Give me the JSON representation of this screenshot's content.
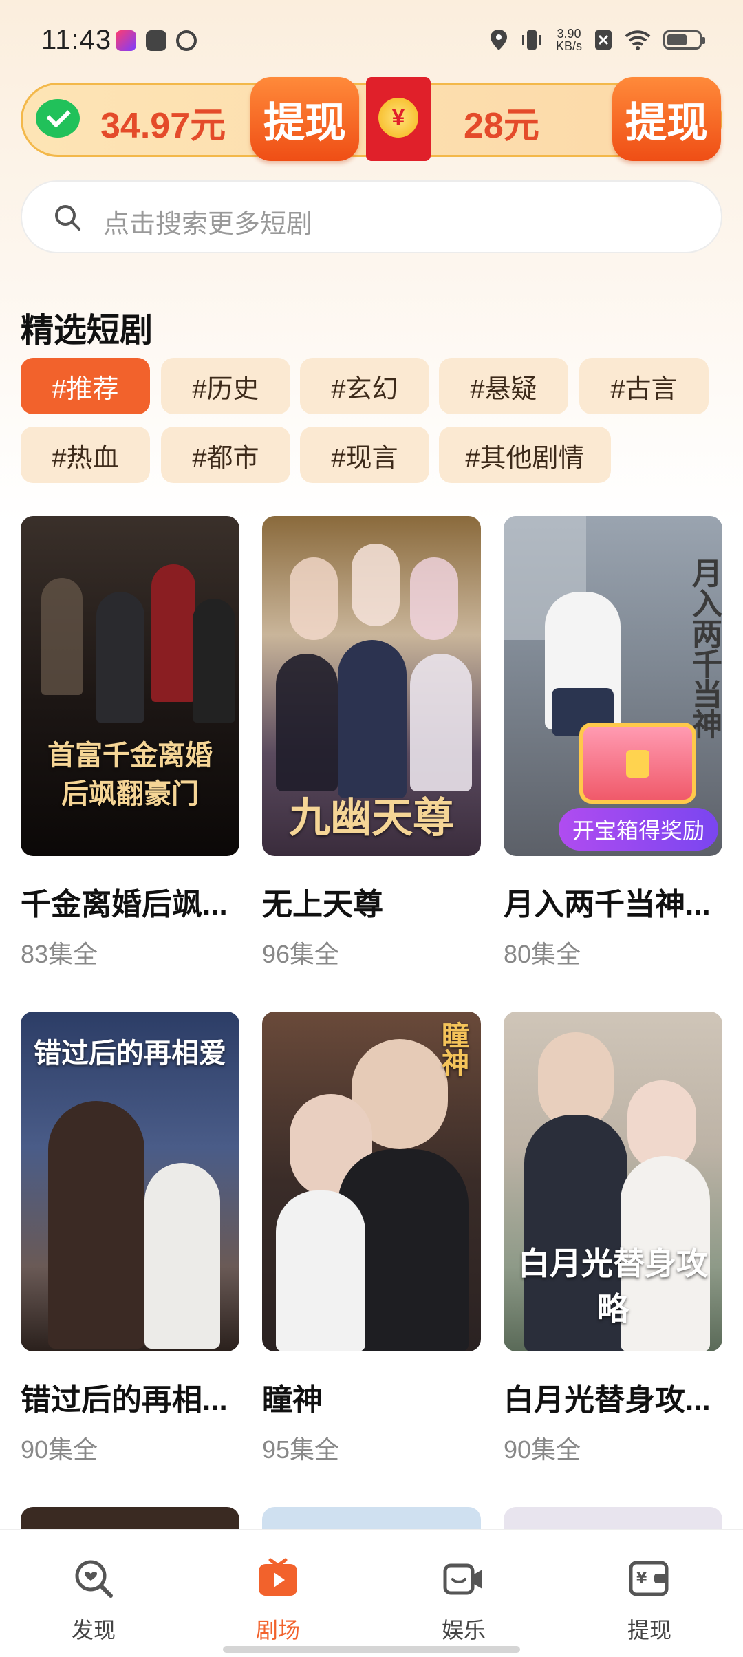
{
  "status_bar": {
    "time": "11:43",
    "net_speed_value": "3.90",
    "net_speed_unit": "KB/s"
  },
  "wallet": {
    "wechat_amount": "34.97元",
    "wechat_withdraw_label": "提现",
    "redpacket_symbol": "¥",
    "redpacket_amount": "28元",
    "redpacket_withdraw_label": "提现"
  },
  "search": {
    "placeholder": "点击搜索更多短剧"
  },
  "section": {
    "title": "精选短剧"
  },
  "tags": [
    {
      "label": "#推荐",
      "active": true
    },
    {
      "label": "#历史",
      "active": false
    },
    {
      "label": "#玄幻",
      "active": false
    },
    {
      "label": "#悬疑",
      "active": false
    },
    {
      "label": "#古言",
      "active": false
    },
    {
      "label": "#热血",
      "active": false
    },
    {
      "label": "#都市",
      "active": false
    },
    {
      "label": "#现言",
      "active": false
    },
    {
      "label": "#其他剧情",
      "active": false
    }
  ],
  "dramas": [
    {
      "title": "千金离婚后飒...",
      "episodes": "83集全",
      "poster_text": "首富千金离婚后飒翻豪门"
    },
    {
      "title": "无上天尊",
      "episodes": "96集全",
      "poster_text": "九幽天尊"
    },
    {
      "title": "月入两千当神...",
      "episodes": "80集全",
      "poster_text": "月入两千当神",
      "badge": "开宝箱得奖励"
    },
    {
      "title": "错过后的再相...",
      "episodes": "90集全",
      "poster_text": "错过后的再相爱"
    },
    {
      "title": "瞳神",
      "episodes": "95集全",
      "poster_text": "瞳神"
    },
    {
      "title": "白月光替身攻...",
      "episodes": "90集全",
      "poster_text": "白月光替身攻略"
    }
  ],
  "bottom_nav": [
    {
      "label": "发现",
      "icon": "discover-icon",
      "active": false
    },
    {
      "label": "剧场",
      "icon": "theater-icon",
      "active": true
    },
    {
      "label": "娱乐",
      "icon": "entertainment-icon",
      "active": false
    },
    {
      "label": "提现",
      "icon": "withdraw-icon",
      "active": false
    }
  ],
  "colors": {
    "accent": "#f2622c",
    "amount": "#e44b2a",
    "tag_bg": "#fbe9d2"
  }
}
